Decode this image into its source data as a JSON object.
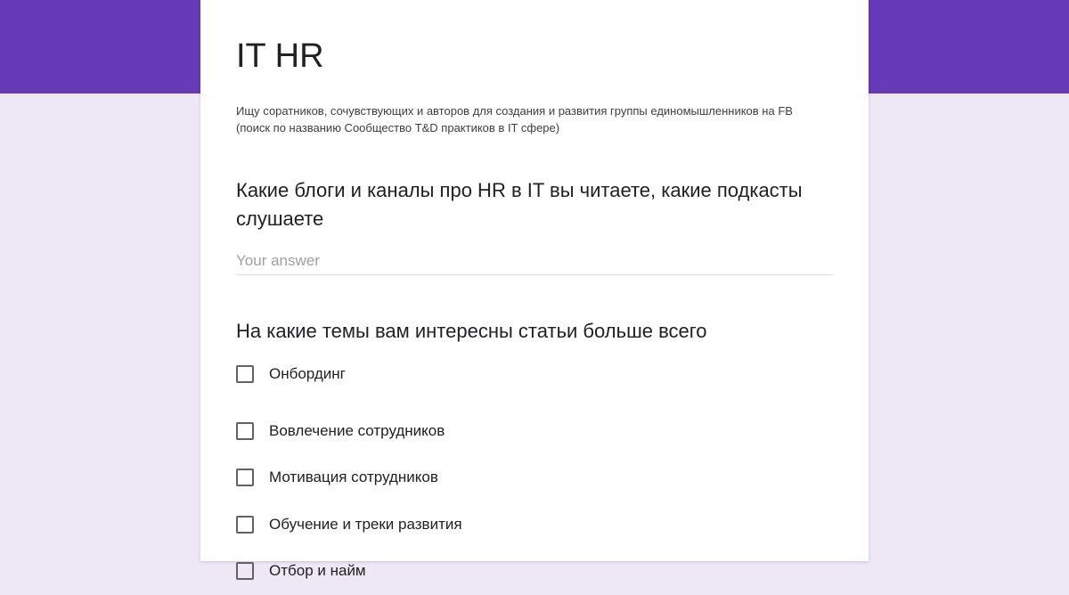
{
  "form": {
    "title": "IT HR",
    "description": "Ищу соратников, сочувствующих и авторов для создания и развития группы единомышленников на FB (поиск по названию Сообщество T&D практиков в IT сфере)",
    "colors": {
      "banner": "#673ab7",
      "background": "#ede7f6",
      "card": "#ffffff"
    }
  },
  "questions": [
    {
      "title": "Какие блоги и каналы про HR в IT вы читаете, какие подкасты слушаете",
      "type": "short-answer",
      "placeholder": "Your answer",
      "value": ""
    },
    {
      "title": "На какие темы вам интересны статьи больше всего",
      "type": "checkboxes",
      "options": [
        {
          "label": "Онбординг",
          "checked": false
        },
        {
          "label": "Вовлечение сотрудников",
          "checked": false
        },
        {
          "label": "Мотивация сотрудников",
          "checked": false
        },
        {
          "label": "Обучение и треки развития",
          "checked": false
        },
        {
          "label": "Отбор и найм",
          "checked": false
        }
      ]
    }
  ]
}
